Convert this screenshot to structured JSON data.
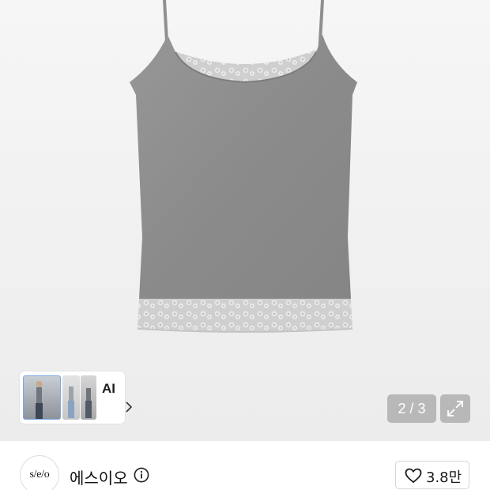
{
  "gallery": {
    "counter": "2 / 3",
    "ai_card_label": "AI",
    "product_image": "gray lace-trim camisole"
  },
  "shop": {
    "logo_text": "s/e/o",
    "name": "에스이오",
    "likes": "3.8만"
  },
  "icons": {
    "expand": "expand-icon",
    "info": "info-icon",
    "heart": "heart-icon",
    "chevron": "chevron-right-icon"
  },
  "colors": {
    "overlay": "#8c8c8c",
    "fabric": "#8e8e8e",
    "lace": "#d8d8d8"
  }
}
